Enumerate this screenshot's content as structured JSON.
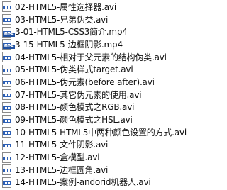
{
  "files": [
    {
      "name": "02-HTML5-属性选择器.avi",
      "icon": "avi-video-file-icon"
    },
    {
      "name": "03-HTML5-兄弟伪类.avi",
      "icon": "avi-video-file-icon"
    },
    {
      "name": "3-01-HTML5-CSS3简介.mp4",
      "icon": "mp4-video-file-icon",
      "badge": "MP4"
    },
    {
      "name": "3-15-HTML5-边框阴影.mp4",
      "icon": "mp4-video-file-icon",
      "badge": "MP4"
    },
    {
      "name": "04-HTML5-相对于父元素的结构伪类.avi",
      "icon": "avi-video-file-icon"
    },
    {
      "name": "05-HTML5-伪类样式target.avi",
      "icon": "avi-video-file-icon"
    },
    {
      "name": "06-HTML5-伪元素(before after).avi",
      "icon": "avi-video-file-icon"
    },
    {
      "name": "07-HTML5-其它伪元素的使用.avi",
      "icon": "avi-video-file-icon"
    },
    {
      "name": "08-HTML5-颜色模式之RGB.avi",
      "icon": "avi-video-file-icon"
    },
    {
      "name": "09-HTML5-颜色模式之HSL.avi",
      "icon": "avi-video-file-icon"
    },
    {
      "name": "10-HTML5-HTML5中两种颜色设置的方式.avi",
      "icon": "avi-video-file-icon"
    },
    {
      "name": "11-HTML5-文件阴影.avi",
      "icon": "avi-video-file-icon"
    },
    {
      "name": "12-HTML5-盒模型.avi",
      "icon": "avi-video-file-icon"
    },
    {
      "name": "13-HTML5-边框圆角.avi",
      "icon": "avi-video-file-icon"
    },
    {
      "name": "14-HTML5-案例-andorid机器人.avi",
      "icon": "avi-video-file-icon"
    }
  ]
}
